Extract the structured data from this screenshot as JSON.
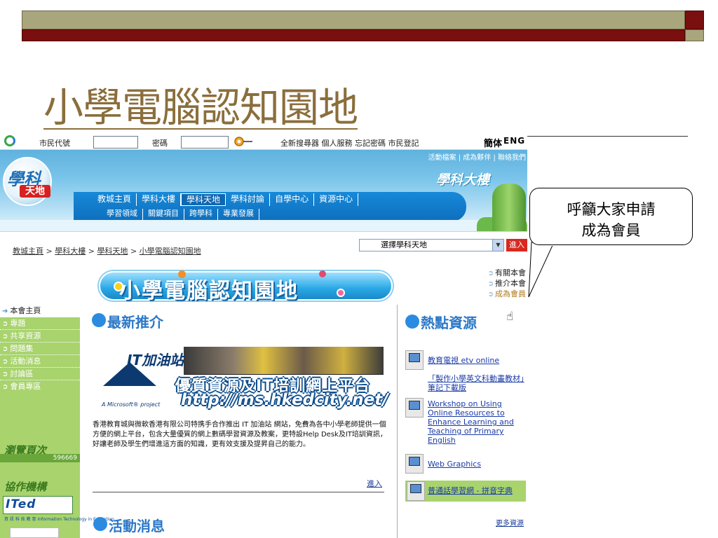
{
  "slide": {
    "title": "小學電腦認知園地",
    "callout": "呼籲大家申請\n成為會員"
  },
  "login": {
    "id_label": "市民代號",
    "pw_label": "密碼",
    "links": "全新搜尋器  個人服務  忘記密碼  市民登記",
    "lang_sc": "簡体",
    "lang_en": "ENG"
  },
  "banner": {
    "top_links": "活動檔案 | 成為夥伴 | 聯絡我們",
    "logo_top": "學科",
    "logo_bottom": "天地",
    "tower_title": "學科大樓",
    "nav_primary": [
      "教城主頁",
      "學科大樓",
      "學科天地",
      "學科討論",
      "自學中心",
      "資源中心"
    ],
    "nav_active": "學科天地",
    "nav_secondary": [
      "學習領域",
      "關鍵項目",
      "跨學科",
      "專業發展"
    ]
  },
  "breadcrumb": {
    "items": [
      "教城主頁",
      "學科大樓",
      "學科天地",
      "小學電腦認知園地"
    ],
    "separator": ">"
  },
  "subject_select": {
    "value": "選擇學科天地",
    "go_label": "進入"
  },
  "hero": {
    "title": "小學電腦認知園地"
  },
  "member_links": [
    {
      "label": "有關本會"
    },
    {
      "label": "推介本會"
    },
    {
      "label": "成為會員"
    }
  ],
  "sidebar": {
    "items": [
      "本會主頁",
      "專題",
      "共享資源",
      "問題集",
      "活動消息",
      "討論區",
      "會員專區"
    ],
    "visits_label": "瀏覽頁次",
    "visits_count": "596669",
    "partner_label": "協作機構",
    "partner_logo": "ITed",
    "partner_sub": "資 訊 科 技 教 育 Information Technology in Education"
  },
  "latest": {
    "heading": "最新推介",
    "it_logo": "IT加油站",
    "ms_project": "A Microsoft® project",
    "slogan1": "優質資源及IT培訓網上平台",
    "slogan2": "http://ms.hkedcity.net/",
    "description": "香港教育城與微軟香港有限公司特携手合作推出 IT 加油站 網站，免費為各中小學老師提供一個方便的網上平台，包含大量優質的網上數碼學習資源及教案，更特設Help Desk及IT培訓資訊，好讓老師及學生們增進這方面的知識，更有效支援及提昇自己的能力。",
    "enter": "進入"
  },
  "activities": {
    "heading": "活動消息"
  },
  "hot": {
    "heading": "熱點資源",
    "items": [
      "教育電視 etv online",
      "「製作小學英文科動畫教材」筆記下載版",
      "Workshop on Using Online Resources to Enhance Learning and Teaching of Primary English",
      "Web Graphics",
      "普通話學習網 - 拼音字典"
    ],
    "more": "更多資源"
  },
  "colors": {
    "slide_olive": "#a9a57c",
    "slide_maroon": "#7a0f0f",
    "title_brown": "#8b6e3c",
    "nav_blue": "#0e6fbe",
    "sidebar_green": "#a8d36d",
    "heading_blue": "#2b78c8"
  }
}
